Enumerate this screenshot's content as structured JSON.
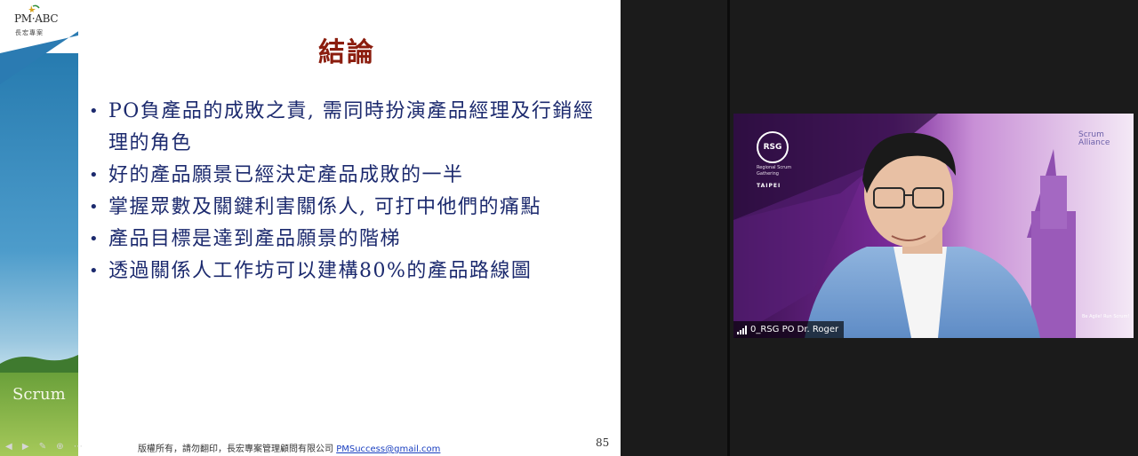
{
  "slide": {
    "logo_text": "PM·ABC",
    "logo_sub": "長宏專案",
    "side_label": "Scrum",
    "title": "結論",
    "bullets": [
      "PO負產品的成敗之責, 需同時扮演產品經理及行銷經理的角色",
      "好的產品願景已經決定產品成敗的一半",
      "掌握眾數及關鍵利害關係人, 可打中他們的痛點",
      "產品目標是達到產品願景的階梯",
      "透過關係人工作坊可以建構80%的產品路線圖"
    ],
    "footer_text": "版權所有，請勿翻印，長宏專案管理顧問有限公司 ",
    "footer_email": "PMSuccess@gmail.com",
    "page_number": "85"
  },
  "video": {
    "rsg_badge": "RSG",
    "rsg_caption": "Regional Scrum Gathering",
    "rsg_city": "TAIPEI",
    "scrum_alliance": "Scrum Alliance",
    "be_agile": "Be Agile! Run Scrum!",
    "participant_name": "0_RSG PO Dr. Roger"
  },
  "colors": {
    "title": "#8b1d0e",
    "bullet_text": "#1c2a6e",
    "email_link": "#1a3fc0",
    "background": "#1b1b1b"
  }
}
